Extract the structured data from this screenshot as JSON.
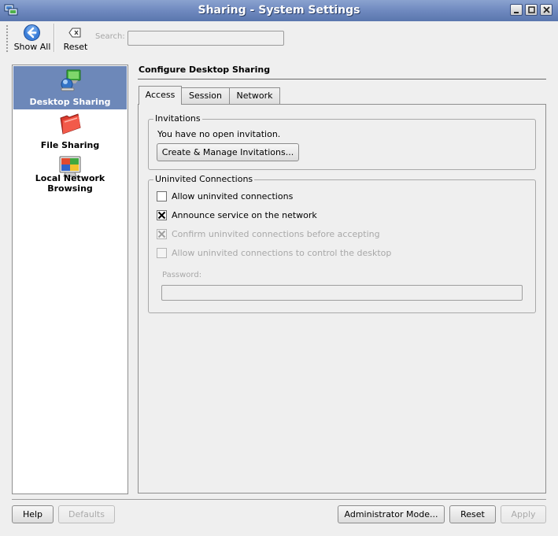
{
  "window": {
    "title": "Sharing - System Settings",
    "controls": {
      "minimize": "minimize-icon",
      "maximize": "maximize-icon",
      "close": "close-icon"
    }
  },
  "toolbar": {
    "show_all_label": "Show All",
    "reset_label": "Reset",
    "search_label": "Search:",
    "search_value": ""
  },
  "sidebar": {
    "items": [
      {
        "label": "Desktop Sharing",
        "icon": "desktop-sharing-icon",
        "selected": true
      },
      {
        "label": "File Sharing",
        "icon": "folder-icon",
        "selected": false
      },
      {
        "label": "Local Network Browsing",
        "icon": "monitor-icon",
        "selected": false
      }
    ]
  },
  "main": {
    "title": "Configure Desktop Sharing",
    "tabs": [
      {
        "label": "Access",
        "active": true
      },
      {
        "label": "Session",
        "active": false
      },
      {
        "label": "Network",
        "active": false
      }
    ],
    "invitations": {
      "title": "Invitations",
      "status": "You have no open invitation.",
      "create_button": "Create & Manage Invitations..."
    },
    "uninvited": {
      "title": "Uninvited Connections",
      "allow": {
        "label": "Allow uninvited connections",
        "checked": false,
        "enabled": true
      },
      "announce": {
        "label": "Announce service on the network",
        "checked": true,
        "enabled": true
      },
      "confirm": {
        "label": "Confirm uninvited connections before accepting",
        "checked": true,
        "enabled": false
      },
      "control": {
        "label": "Allow uninvited connections to control the desktop",
        "checked": false,
        "enabled": false
      },
      "password_label": "Password:",
      "password_value": ""
    }
  },
  "footer": {
    "help": "Help",
    "defaults": "Defaults",
    "admin_mode": "Administrator Mode...",
    "reset": "Reset",
    "apply": "Apply"
  },
  "colors": {
    "titlebar": "#6f89bf",
    "selection": "#6d88b9",
    "background": "#efefef"
  }
}
